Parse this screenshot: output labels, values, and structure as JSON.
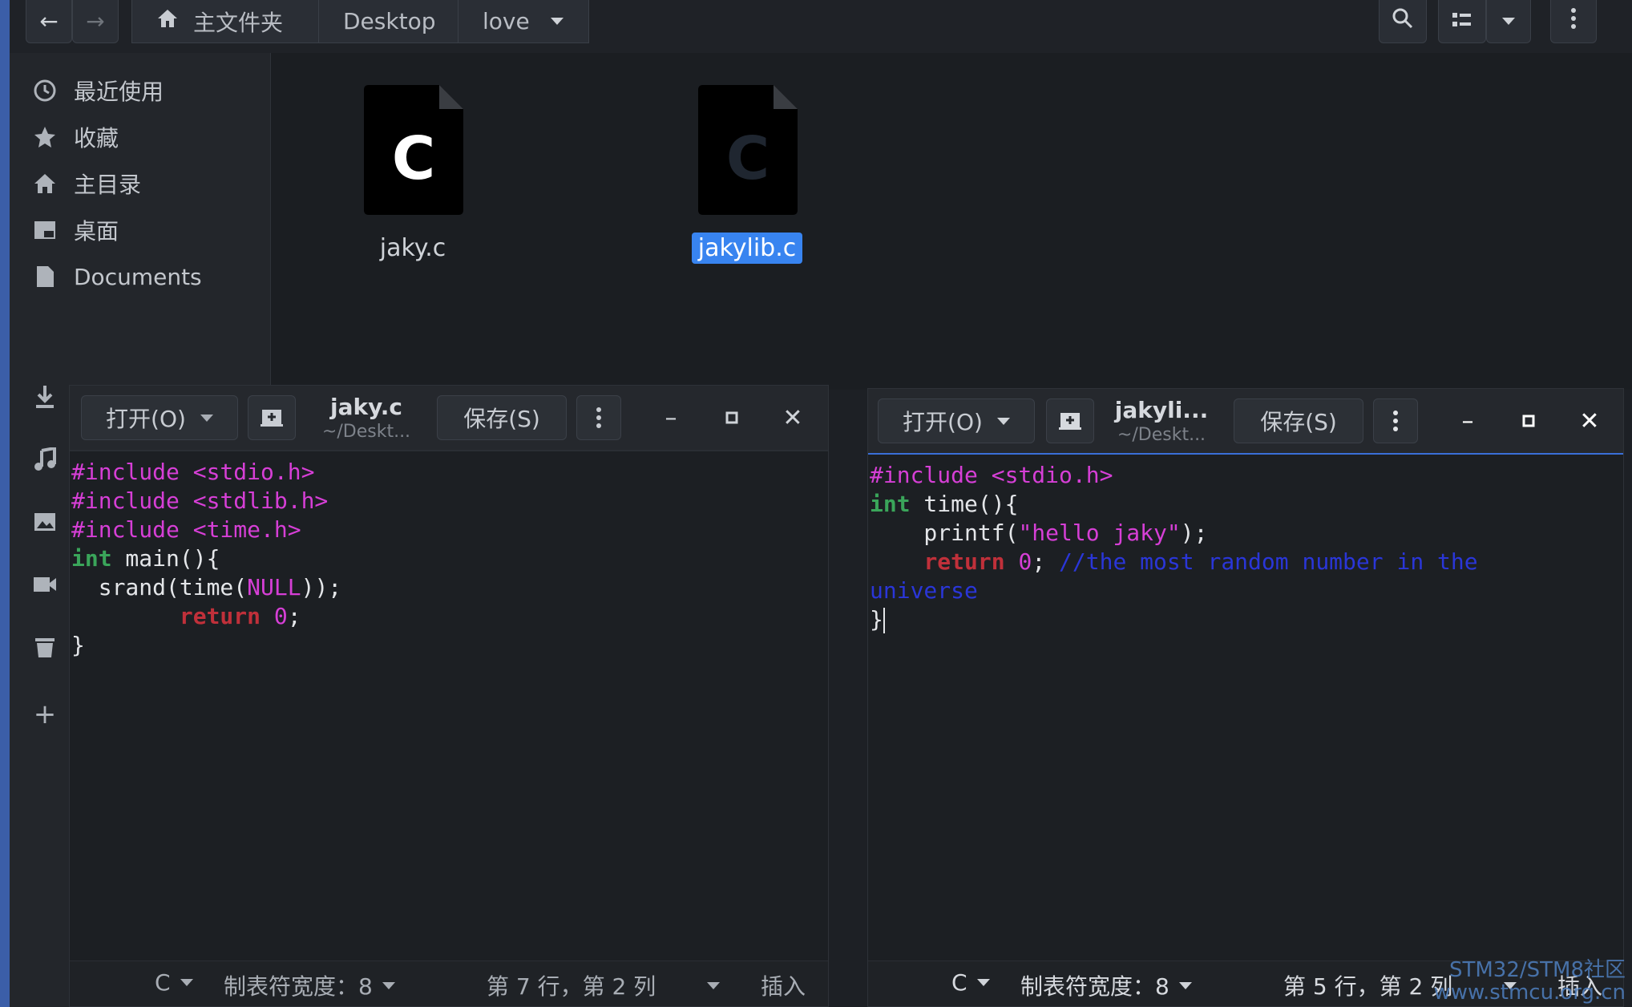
{
  "header": {
    "breadcrumbs": [
      "主文件夹",
      "Desktop",
      "love"
    ]
  },
  "sidebar": {
    "items": [
      {
        "label": "最近使用",
        "icon": "clock-icon"
      },
      {
        "label": "收藏",
        "icon": "star-icon"
      },
      {
        "label": "主目录",
        "icon": "home-icon"
      },
      {
        "label": "桌面",
        "icon": "desktop-icon"
      },
      {
        "label": "Documents",
        "icon": "document-icon"
      }
    ]
  },
  "files": [
    {
      "name": "jaky.c",
      "icon_letter": "C",
      "selected": false
    },
    {
      "name": "jakylib.c",
      "icon_letter": "C",
      "selected": true
    }
  ],
  "editor_left": {
    "open_label": "打开(O)",
    "title": "jaky.c",
    "subtitle": "~/Deskt...",
    "save_label": "保存(S)",
    "code_lines": [
      "#include <stdio.h>",
      "#include <stdlib.h>",
      "#include <time.h>",
      "int main(){",
      "  srand(time(NULL));",
      "        return 0;",
      "}"
    ],
    "status": {
      "language": "C",
      "tab_width": "制表符宽度：8",
      "position": "第 7 行，第 2 列",
      "mode": "插入"
    }
  },
  "editor_right": {
    "open_label": "打开(O)",
    "title": "jakyli...",
    "subtitle": "~/Deskt...",
    "save_label": "保存(S)",
    "code_lines": [
      "#include <stdio.h>",
      "int time(){",
      "    printf(\"hello jaky\");",
      "    return 0; //the most random number in the",
      "universe",
      "}"
    ],
    "status": {
      "language": "C",
      "tab_width": "制表符宽度：8",
      "position": "第 5 行，第 2 列",
      "mode": "插入"
    }
  },
  "watermark": {
    "line1": "STM32/STM8社区",
    "line2": "www.stmcu.org.cn"
  }
}
